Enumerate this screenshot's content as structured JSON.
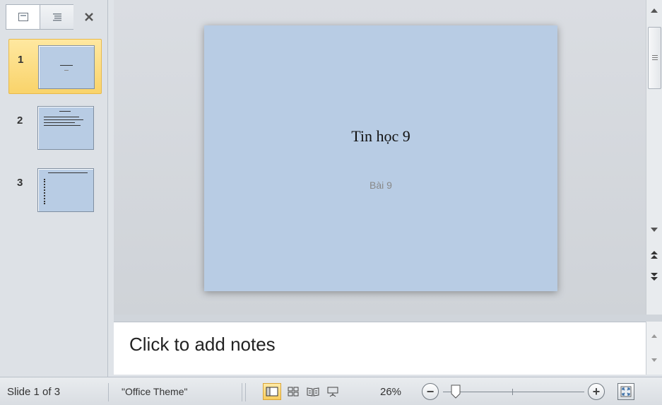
{
  "left_panel": {
    "tabs": [
      {
        "name": "slides-tab",
        "icon": "slide-icon"
      },
      {
        "name": "outline-tab",
        "icon": "outline-icon"
      },
      {
        "name": "close-pane",
        "icon": "close-icon"
      }
    ],
    "thumbnails": [
      {
        "number": "1",
        "selected": true
      },
      {
        "number": "2",
        "selected": false
      },
      {
        "number": "3",
        "selected": false
      }
    ]
  },
  "slide": {
    "title": "Tin  học 9",
    "subtitle": "Bài 9"
  },
  "notes": {
    "placeholder": "Click to add notes"
  },
  "status_bar": {
    "slide_info": "Slide 1 of 3",
    "theme": "\"Office Theme\"",
    "zoom": "26%",
    "zoom_level_percent": 26
  },
  "colors": {
    "slide_background": "#b8cce4",
    "selection_accent": "#f9d36a"
  }
}
